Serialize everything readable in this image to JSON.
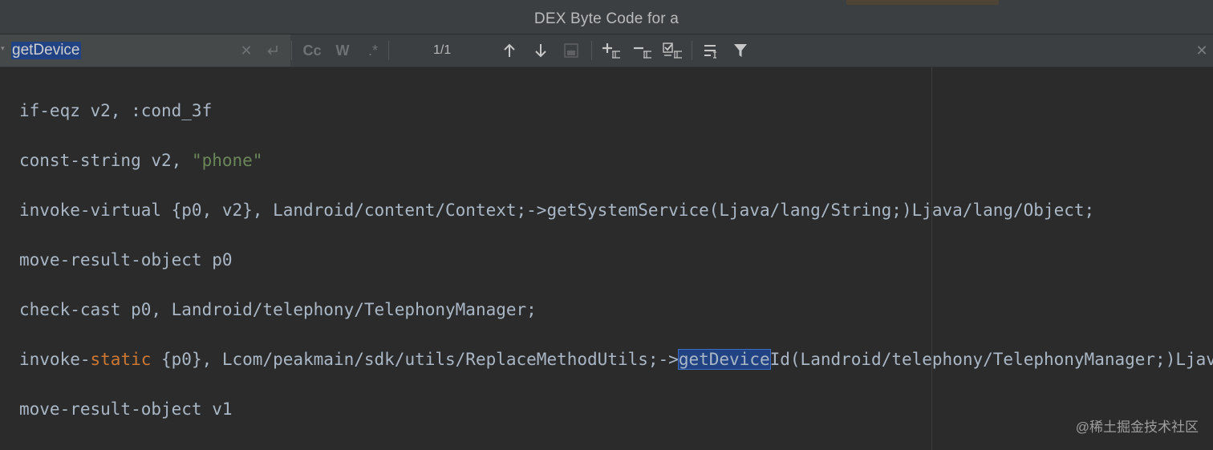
{
  "window": {
    "title": "DEX Byte Code for a"
  },
  "search": {
    "query": "getDevice",
    "match_count": "1/1",
    "case_label": "Cc",
    "words_label": "W",
    "regex_label": ".*"
  },
  "editor": {
    "lines": [
      {
        "text": "if-eqz v2, :cond_3f"
      },
      {
        "pre": "const-string v2, ",
        "str": "\"phone\""
      },
      {
        "text": "invoke-virtual {p0, v2}, Landroid/content/Context;->getSystemService(Ljava/lang/String;)Ljava/lang/Object;"
      },
      {
        "text": "move-result-object p0"
      },
      {
        "text": "check-cast p0, Landroid/telephony/TelephonyManager;"
      },
      {
        "pre": "invoke-",
        "kw": "static",
        "mid": " {p0}, Lcom/peakmain/sdk/utils/ReplaceMethodUtils;->",
        "match": "getDevice",
        "post": "Id(Landroid/telephony/TelephonyManager;)Ljava/lang/S"
      },
      {
        "text": "move-result-object v1"
      }
    ]
  },
  "watermark": "@稀土掘金技术社区",
  "colors": {
    "background": "#2b2b2b",
    "toolbar": "#3c3f41",
    "selection": "#214283",
    "string": "#6a8759",
    "keyword": "#cc7832",
    "text": "#a9b7c6"
  },
  "icons": [
    "chevron-down-icon",
    "clear-icon",
    "newline-icon",
    "arrow-up-icon",
    "arrow-down-icon",
    "select-all-occurrences-icon",
    "add-occurrence-icon",
    "remove-occurrence-icon",
    "select-occurrence-icon",
    "filter-options-icon",
    "filter-icon",
    "close-icon"
  ]
}
